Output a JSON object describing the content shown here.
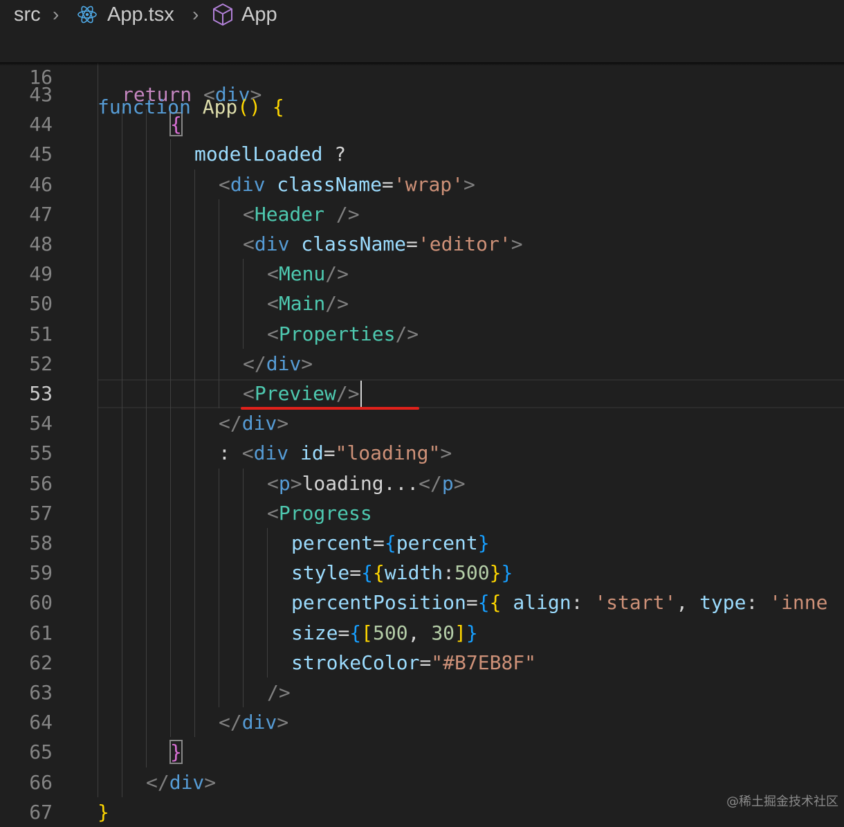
{
  "breadcrumb": {
    "items": [
      "src",
      "App.tsx",
      "App"
    ],
    "icons": [
      "chevron-right-icon",
      "react-icon",
      "component-cube-icon"
    ]
  },
  "editor": {
    "current_line": "53",
    "sticky_line": {
      "number": "16",
      "tokens": [
        [
          "kw",
          "function "
        ],
        [
          "fn",
          "App"
        ],
        [
          "b1",
          "()"
        ],
        [
          "plain",
          " "
        ],
        [
          "b1",
          "{"
        ]
      ]
    },
    "lines": [
      {
        "n": "43",
        "indent": 1,
        "tokens": [
          [
            "ctl",
            "return "
          ],
          [
            "pn",
            "<"
          ],
          [
            "tag",
            "div"
          ],
          [
            "pn",
            ">"
          ]
        ]
      },
      {
        "n": "44",
        "indent": 3,
        "tokens": [
          [
            "b2 hl",
            "{"
          ]
        ]
      },
      {
        "n": "45",
        "indent": 4,
        "tokens": [
          [
            "var",
            "modelLoaded"
          ],
          [
            "plain",
            " ?"
          ]
        ]
      },
      {
        "n": "46",
        "indent": 5,
        "tokens": [
          [
            "pn",
            "<"
          ],
          [
            "tag",
            "div"
          ],
          [
            "plain",
            " "
          ],
          [
            "attr",
            "className"
          ],
          [
            "plain",
            "="
          ],
          [
            "str",
            "'wrap'"
          ],
          [
            "pn",
            ">"
          ]
        ]
      },
      {
        "n": "47",
        "indent": 6,
        "tokens": [
          [
            "pn",
            "<"
          ],
          [
            "comp",
            "Header"
          ],
          [
            "plain",
            " "
          ],
          [
            "pn",
            "/>"
          ]
        ]
      },
      {
        "n": "48",
        "indent": 6,
        "tokens": [
          [
            "pn",
            "<"
          ],
          [
            "tag",
            "div"
          ],
          [
            "plain",
            " "
          ],
          [
            "attr",
            "className"
          ],
          [
            "plain",
            "="
          ],
          [
            "str",
            "'editor'"
          ],
          [
            "pn",
            ">"
          ]
        ]
      },
      {
        "n": "49",
        "indent": 7,
        "tokens": [
          [
            "pn",
            "<"
          ],
          [
            "comp",
            "Menu"
          ],
          [
            "pn",
            "/>"
          ]
        ]
      },
      {
        "n": "50",
        "indent": 7,
        "tokens": [
          [
            "pn",
            "<"
          ],
          [
            "comp",
            "Main"
          ],
          [
            "pn",
            "/>"
          ]
        ]
      },
      {
        "n": "51",
        "indent": 7,
        "tokens": [
          [
            "pn",
            "<"
          ],
          [
            "comp",
            "Properties"
          ],
          [
            "pn",
            "/>"
          ]
        ]
      },
      {
        "n": "52",
        "indent": 6,
        "tokens": [
          [
            "pn",
            "</"
          ],
          [
            "tag",
            "div"
          ],
          [
            "pn",
            ">"
          ]
        ]
      },
      {
        "n": "53",
        "indent": 6,
        "tokens": [
          [
            "pn",
            "<"
          ],
          [
            "comp",
            "Preview"
          ],
          [
            "pn",
            "/>"
          ]
        ]
      },
      {
        "n": "54",
        "indent": 5,
        "tokens": [
          [
            "pn",
            "</"
          ],
          [
            "tag",
            "div"
          ],
          [
            "pn",
            ">"
          ]
        ]
      },
      {
        "n": "55",
        "indent": 5,
        "tokens": [
          [
            "plain",
            ": "
          ],
          [
            "pn",
            "<"
          ],
          [
            "tag",
            "div"
          ],
          [
            "plain",
            " "
          ],
          [
            "attr",
            "id"
          ],
          [
            "plain",
            "="
          ],
          [
            "str",
            "\"loading\""
          ],
          [
            "pn",
            ">"
          ]
        ]
      },
      {
        "n": "56",
        "indent": 7,
        "tokens": [
          [
            "pn",
            "<"
          ],
          [
            "tag",
            "p"
          ],
          [
            "pn",
            ">"
          ],
          [
            "plain",
            "loading..."
          ],
          [
            "pn",
            "</"
          ],
          [
            "tag",
            "p"
          ],
          [
            "pn",
            ">"
          ]
        ]
      },
      {
        "n": "57",
        "indent": 7,
        "tokens": [
          [
            "pn",
            "<"
          ],
          [
            "comp",
            "Progress"
          ]
        ]
      },
      {
        "n": "58",
        "indent": 8,
        "tokens": [
          [
            "attr",
            "percent"
          ],
          [
            "plain",
            "="
          ],
          [
            "b3",
            "{"
          ],
          [
            "var",
            "percent"
          ],
          [
            "b3",
            "}"
          ]
        ]
      },
      {
        "n": "59",
        "indent": 8,
        "tokens": [
          [
            "attr",
            "style"
          ],
          [
            "plain",
            "="
          ],
          [
            "b3",
            "{"
          ],
          [
            "b1",
            "{"
          ],
          [
            "var",
            "width"
          ],
          [
            "plain",
            ":"
          ],
          [
            "num",
            "500"
          ],
          [
            "b1",
            "}"
          ],
          [
            "b3",
            "}"
          ]
        ]
      },
      {
        "n": "60",
        "indent": 8,
        "tokens": [
          [
            "attr",
            "percentPosition"
          ],
          [
            "plain",
            "="
          ],
          [
            "b3",
            "{"
          ],
          [
            "b1",
            "{"
          ],
          [
            "plain",
            " "
          ],
          [
            "var",
            "align"
          ],
          [
            "plain",
            ": "
          ],
          [
            "str",
            "'start'"
          ],
          [
            "plain",
            ", "
          ],
          [
            "var",
            "type"
          ],
          [
            "plain",
            ": "
          ],
          [
            "str",
            "'inne"
          ]
        ]
      },
      {
        "n": "61",
        "indent": 8,
        "tokens": [
          [
            "attr",
            "size"
          ],
          [
            "plain",
            "="
          ],
          [
            "b3",
            "{"
          ],
          [
            "b1",
            "["
          ],
          [
            "num",
            "500"
          ],
          [
            "plain",
            ", "
          ],
          [
            "num",
            "30"
          ],
          [
            "b1",
            "]"
          ],
          [
            "b3",
            "}"
          ]
        ]
      },
      {
        "n": "62",
        "indent": 8,
        "tokens": [
          [
            "attr",
            "strokeColor"
          ],
          [
            "plain",
            "="
          ],
          [
            "str",
            "\"#B7EB8F\""
          ]
        ]
      },
      {
        "n": "63",
        "indent": 7,
        "tokens": [
          [
            "pn",
            "/>"
          ]
        ]
      },
      {
        "n": "64",
        "indent": 5,
        "tokens": [
          [
            "pn",
            "</"
          ],
          [
            "tag",
            "div"
          ],
          [
            "pn",
            ">"
          ]
        ]
      },
      {
        "n": "65",
        "indent": 3,
        "tokens": [
          [
            "b2 hl",
            "}"
          ]
        ]
      },
      {
        "n": "66",
        "indent": 2,
        "tokens": [
          [
            "pn",
            "</"
          ],
          [
            "tag",
            "div"
          ],
          [
            "pn",
            ">"
          ]
        ]
      },
      {
        "n": "67",
        "indent": 0,
        "tokens": [
          [
            "b1",
            "}"
          ]
        ]
      }
    ]
  },
  "watermark": "@稀土掘金技术社区",
  "colors": {
    "background": "#1f1f1f",
    "annotation_underline": "#e0211b"
  }
}
